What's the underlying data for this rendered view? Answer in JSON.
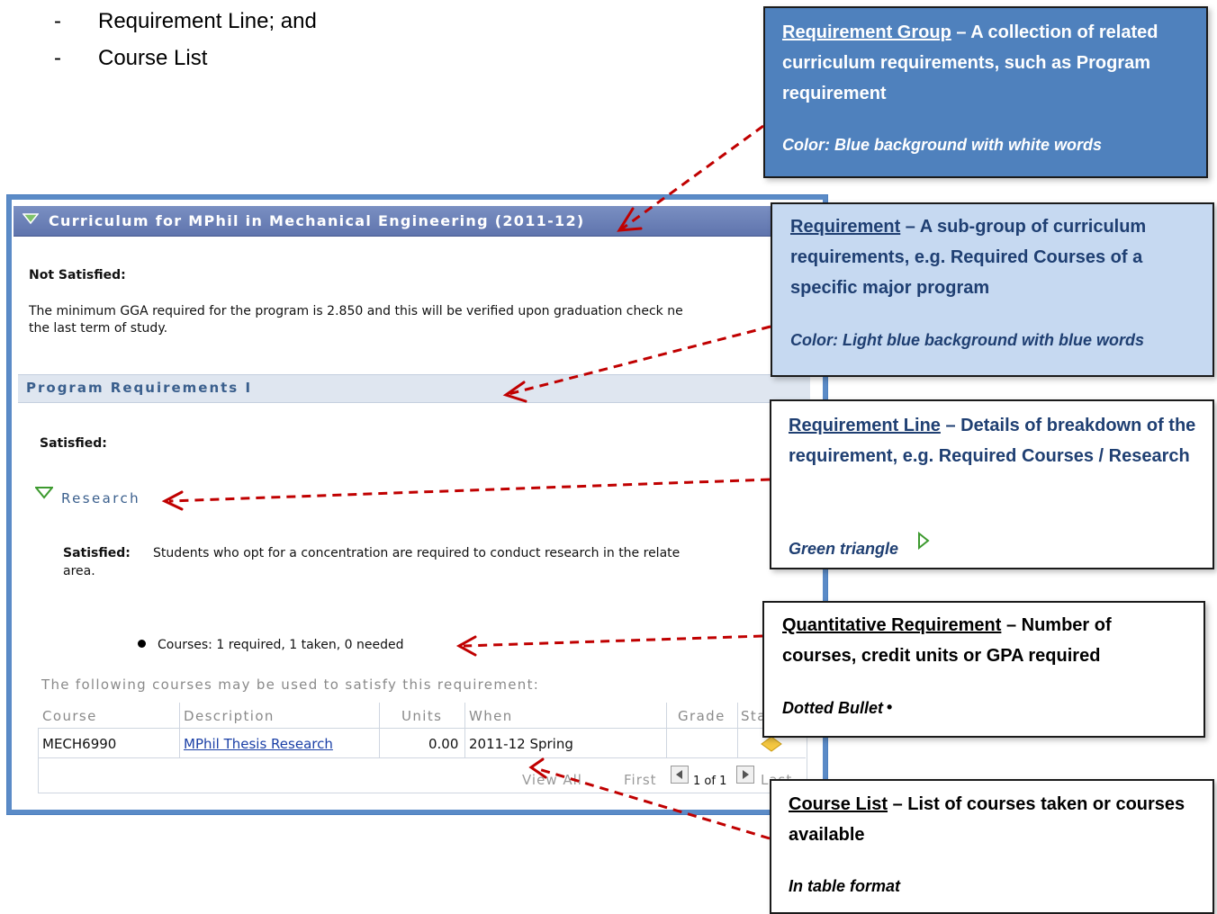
{
  "intro_list": [
    {
      "dash": "-",
      "text": "Requirement Line; and"
    },
    {
      "dash": "-",
      "text": "Course List"
    }
  ],
  "screenshot": {
    "group_title": "Curriculum for MPhil in Mechanical Engineering (2011-12)",
    "not_satisfied_label": "Not Satisfied:",
    "gga_text_line1": "The minimum GGA required for the program is 2.850 and this will be verified upon graduation check ne",
    "gga_text_line2": "the last term of study.",
    "requirement_title": "Program Requirements I",
    "satisfied_label": "Satisfied:",
    "line_title": "Research",
    "line_satisfied_label": "Satisfied:",
    "line_desc_line1": "Students who opt for a concentration are required to conduct research in the relate",
    "line_desc_line2": "area.",
    "courses_summary": "Courses: 1 required, 1 taken, 0 needed",
    "table_caption": "The following courses may be used to satisfy this requirement:",
    "table": {
      "columns": [
        "Course",
        "Description",
        "Units",
        "When",
        "Grade",
        "Sta"
      ],
      "rows": [
        {
          "course": "MECH6990",
          "description": "MPhil Thesis Research",
          "units": "0.00",
          "when": "2011-12 Spring",
          "grade": ""
        }
      ],
      "pager": {
        "view_all": "View All",
        "first": "First",
        "page": "1 of 1",
        "last": "Last"
      }
    }
  },
  "callouts": {
    "group": {
      "term": "Requirement Group",
      "desc": " – A collection of related curriculum requirements, such as Program requirement",
      "color": "Color: Blue background with white words",
      "bg": "#4f81bd"
    },
    "requirement": {
      "term": "Requirement",
      "desc": " – A sub-group of curriculum requirements, e.g. Required Courses of a specific major program",
      "color": "Color: Light blue background with blue words",
      "bg": "#c6d9f1"
    },
    "line": {
      "term": "Requirement Line",
      "desc": " – Details of breakdown of the requirement, e.g. Required Courses / Research",
      "note": "Green triangle"
    },
    "quant": {
      "term": "Quantitative Requirement",
      "desc": " – Number of courses, credit units or GPA required",
      "note": "Dotted Bullet",
      "bullet": "•"
    },
    "courselist": {
      "term": "Course List",
      "desc": " – List of courses taken or courses available",
      "note": "In table format"
    }
  }
}
